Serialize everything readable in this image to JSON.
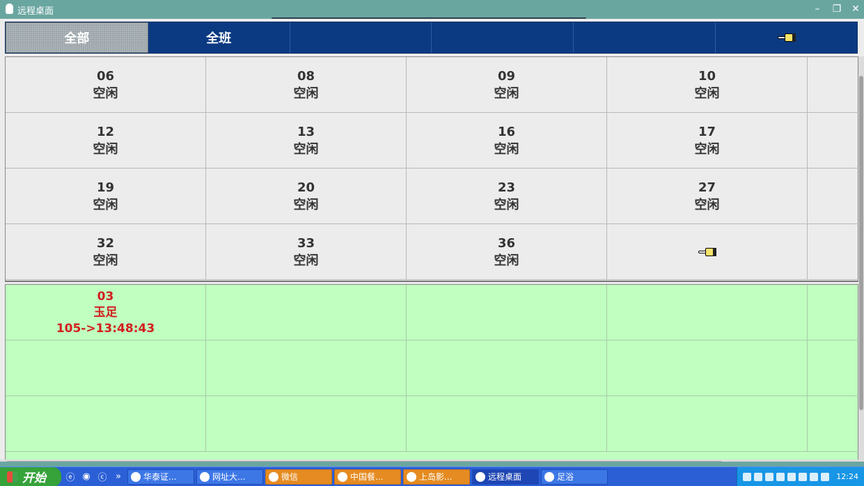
{
  "window": {
    "title": "远程桌面",
    "controls": {
      "minimize": "–",
      "restore": "❐",
      "close": "✕"
    }
  },
  "tabs": [
    {
      "label": "全部",
      "active": true
    },
    {
      "label": "全班",
      "active": false
    },
    {
      "label": "",
      "active": false
    },
    {
      "label": "",
      "active": false
    },
    {
      "label": "",
      "active": false
    },
    {
      "label": "",
      "icon": "pointing-hand-icon",
      "active": false
    }
  ],
  "rooms": [
    {
      "number": "06",
      "status": "空闲"
    },
    {
      "number": "08",
      "status": "空闲"
    },
    {
      "number": "09",
      "status": "空闲"
    },
    {
      "number": "10",
      "status": "空闲"
    },
    {
      "number": "12",
      "status": "空闲"
    },
    {
      "number": "13",
      "status": "空闲"
    },
    {
      "number": "16",
      "status": "空闲"
    },
    {
      "number": "17",
      "status": "空闲"
    },
    {
      "number": "19",
      "status": "空闲"
    },
    {
      "number": "20",
      "status": "空闲"
    },
    {
      "number": "23",
      "status": "空闲"
    },
    {
      "number": "27",
      "status": "空闲"
    },
    {
      "number": "32",
      "status": "空闲"
    },
    {
      "number": "33",
      "status": "空闲"
    },
    {
      "number": "36",
      "status": "空闲"
    }
  ],
  "active_rooms": [
    {
      "number": "03",
      "service": "玉足",
      "timer": "105->13:48:43"
    }
  ],
  "taskbar": {
    "start_label": "开始",
    "tasks": [
      {
        "label": "华泰证...",
        "style": "normal"
      },
      {
        "label": "网址大...",
        "style": "normal"
      },
      {
        "label": "微信",
        "style": "orange"
      },
      {
        "label": "中国餐...",
        "style": "orange"
      },
      {
        "label": "上岛影...",
        "style": "orange"
      },
      {
        "label": "远程桌面",
        "style": "active"
      },
      {
        "label": "足浴",
        "style": "normal"
      }
    ],
    "clock": "12:24"
  },
  "colors": {
    "tab_bg": "#0b3a82",
    "idle_cell_bg": "#ececec",
    "active_cell_bg": "#c0ffc0",
    "active_text": "#d21e1e"
  }
}
